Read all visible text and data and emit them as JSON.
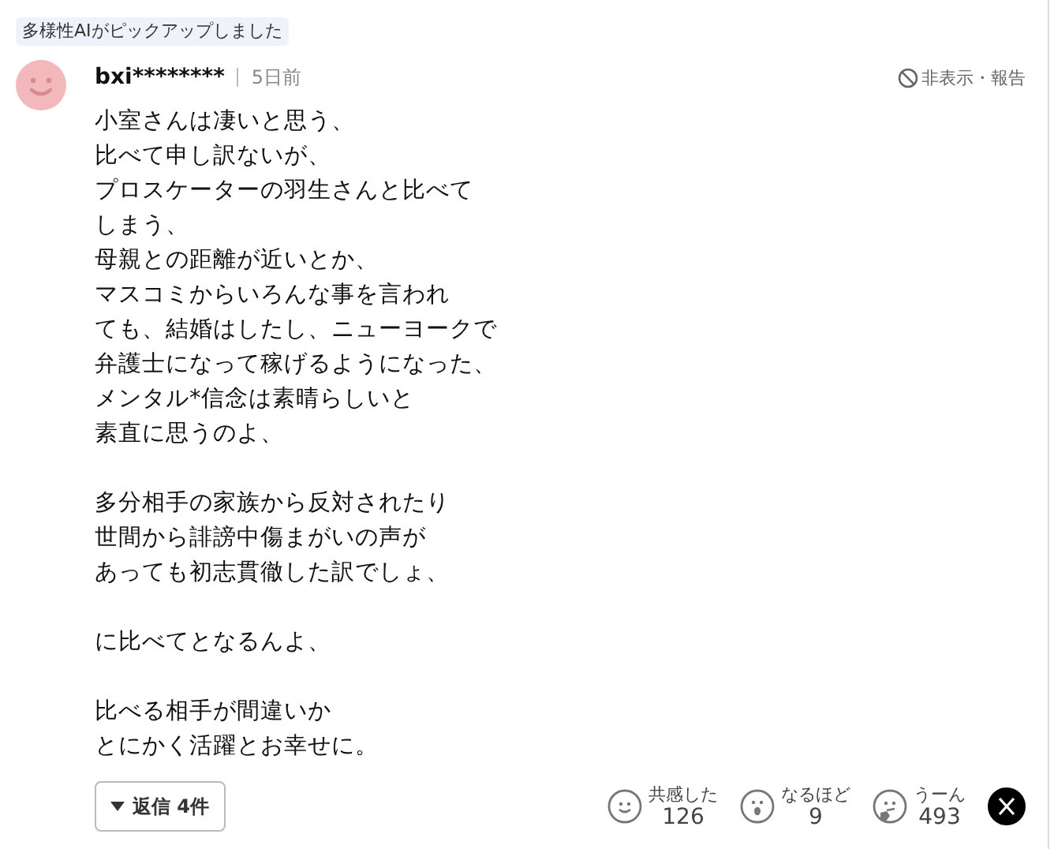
{
  "badge": "多様性AIがピックアップしました",
  "comment": {
    "user": "bxi********",
    "time": "5日前",
    "hide_report": "非表示・報告",
    "paragraphs": [
      [
        "小室さんは凄いと思う、",
        "比べて申し訳ないが、",
        "プロスケーターの羽生さんと比べて",
        "しまう、",
        "母親との距離が近いとか、",
        "マスコミからいろんな事を言われ",
        "ても、結婚はしたし、ニューヨークで",
        "弁護士になって稼げるようになった、",
        "メンタル*信念は素晴らしいと",
        "素直に思うのよ、"
      ],
      [
        "多分相手の家族から反対されたり",
        "世間から誹謗中傷まがいの声が",
        "あっても初志貫徹した訳でしょ、"
      ],
      [
        "に比べてとなるんよ、"
      ],
      [
        "比べる相手が間違いか",
        "とにかく活躍とお幸せに。"
      ]
    ],
    "replies_button": "返信 4件",
    "reactions": [
      {
        "kind": "smile",
        "label": "共感した",
        "count": "126"
      },
      {
        "kind": "surprise",
        "label": "なるほど",
        "count": "9"
      },
      {
        "kind": "think",
        "label": "うーん",
        "count": "493"
      }
    ]
  }
}
